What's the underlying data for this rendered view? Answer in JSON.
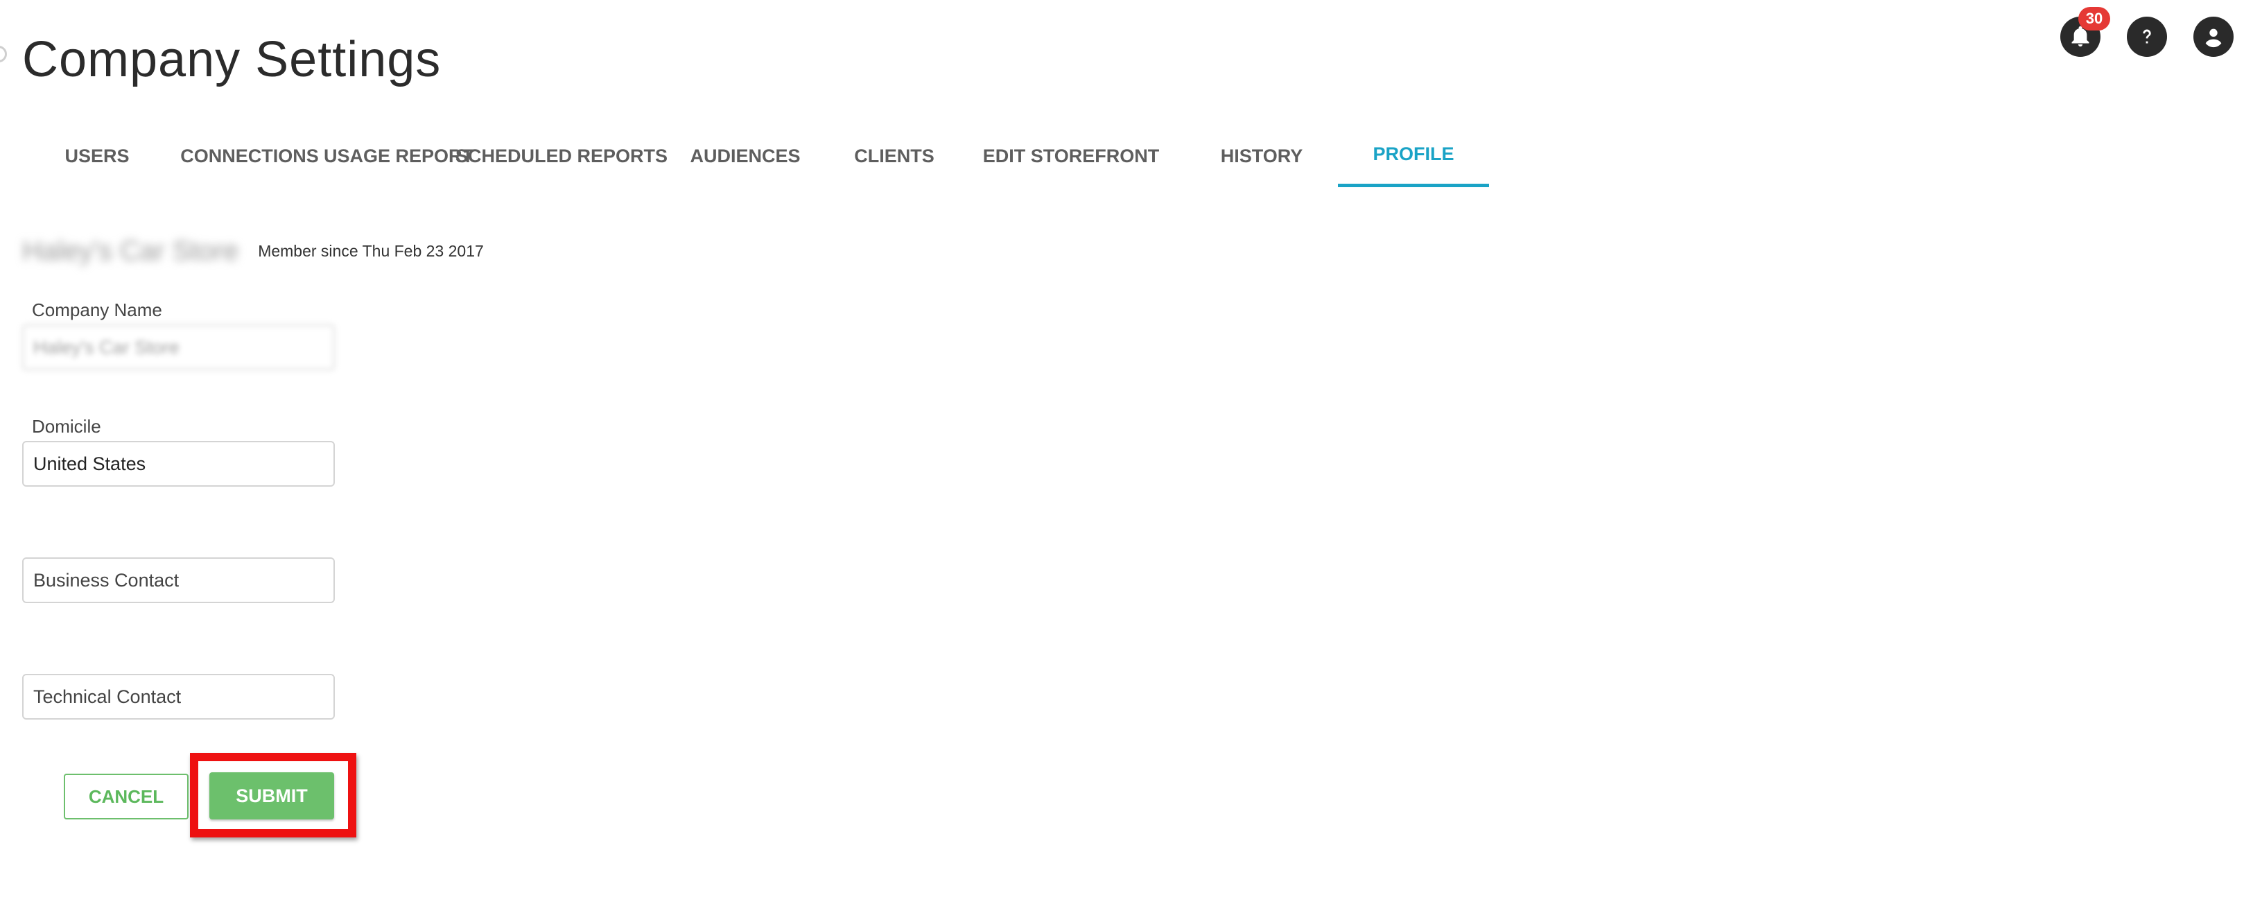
{
  "page": {
    "title": "Company Settings"
  },
  "header": {
    "notifications_count": "30",
    "icons": [
      "bell-icon",
      "help-icon",
      "account-icon"
    ]
  },
  "tabs": [
    {
      "label": "USERS",
      "active": false
    },
    {
      "label": "CONNECTIONS",
      "active": false
    },
    {
      "label": "USAGE REPORT",
      "active": false
    },
    {
      "label": "SCHEDULED REPORTS",
      "active": false
    },
    {
      "label": "AUDIENCES",
      "active": false
    },
    {
      "label": "CLIENTS",
      "active": false
    },
    {
      "label": "EDIT STOREFRONT",
      "active": false
    },
    {
      "label": "HISTORY",
      "active": false
    },
    {
      "label": "PROFILE",
      "active": true
    }
  ],
  "profile": {
    "company_display_name": "Haley's Car Store",
    "member_since": "Member since Thu Feb 23 2017",
    "company_name_label": "Company Name",
    "company_name_value": "Haley's Car Store",
    "domicile_label": "Domicile",
    "domicile_value": "United States",
    "business_contact_placeholder": "Business Contact",
    "technical_contact_placeholder": "Technical Contact"
  },
  "actions": {
    "cancel_label": "CANCEL",
    "submit_label": "SUBMIT"
  },
  "colors": {
    "accent": "#1aa3c6",
    "primary_green": "#6cc06c",
    "badge_red": "#e53935",
    "highlight_red": "#ee1111"
  }
}
